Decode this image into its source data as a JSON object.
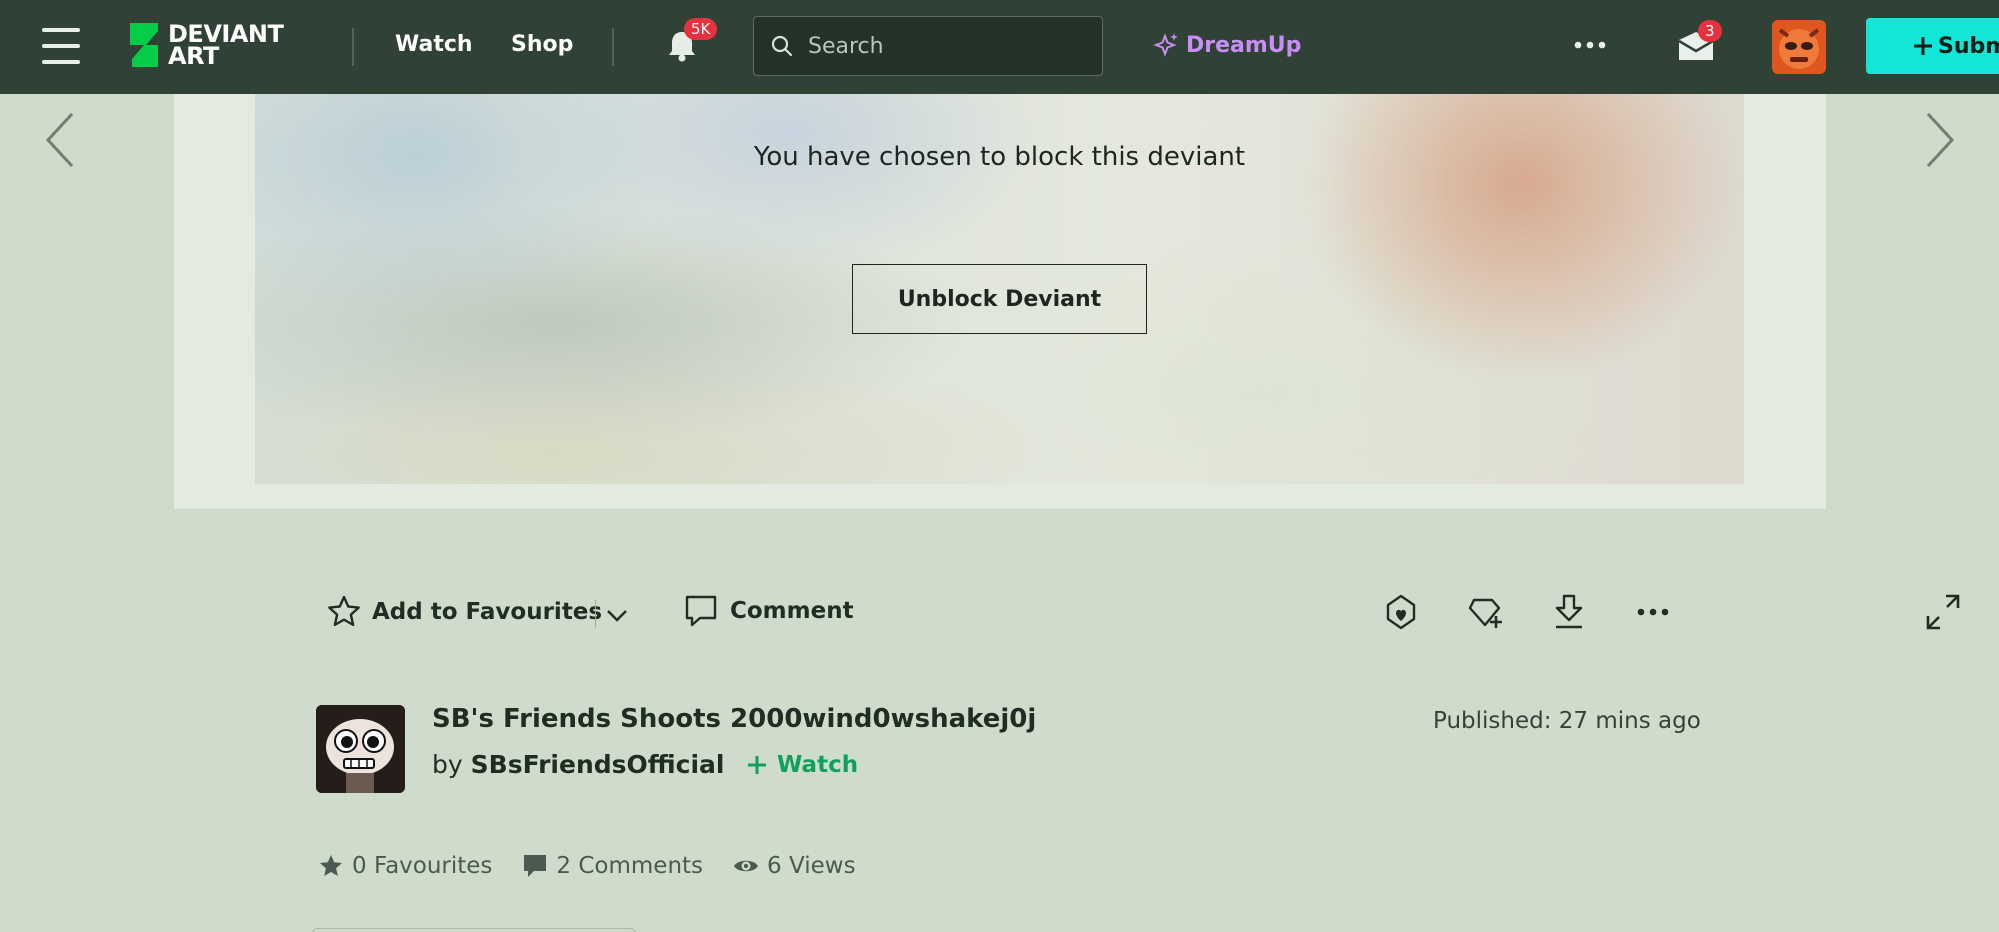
{
  "topbar": {
    "logo_line1": "DEVIANT",
    "logo_line2": "ART",
    "nav_watch": "Watch",
    "nav_shop": "Shop",
    "notifications_badge": "5K",
    "search_placeholder": "Search",
    "dreamup_label": "DreamUp",
    "messages_badge": "3",
    "submit_label": "Submit"
  },
  "stage": {
    "block_message": "You have chosen to block this deviant",
    "unblock_label": "Unblock Deviant"
  },
  "actions": {
    "favourite_label": "Add to Favourites",
    "comment_label": "Comment"
  },
  "deviation": {
    "title": "SB's Friends Shoots 2000wind0wshakej0j",
    "by_prefix": "by",
    "author": "SBsFriendsOfficial",
    "watch_label": "Watch",
    "published": "Published: 27 mins ago"
  },
  "stats": {
    "favourites": "0 Favourites",
    "comments": "2 Comments",
    "views": "6 Views"
  },
  "colors": {
    "topbar_bg": "#2f4235",
    "page_bg": "#cfdccb",
    "accent_green": "#11a05c",
    "submit_bg": "#12e6d7",
    "badge_red": "#e5323e",
    "dreamup_purple": "#c98ef5"
  }
}
